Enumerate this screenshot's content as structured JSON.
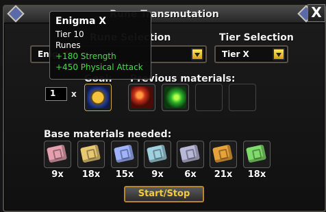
{
  "window": {
    "title": "Rune Transmutation",
    "close_label": "X"
  },
  "rune_selection": {
    "label": "Rune Selection",
    "value": "Enig"
  },
  "tier_selection": {
    "label": "Tier Selection",
    "value": "Tier X"
  },
  "goal": {
    "label": "Goal:",
    "quantity": "1",
    "multiplier": "x",
    "icon": "golden-rune-icon"
  },
  "previous_materials": {
    "label": "Previous materials:",
    "slots": [
      {
        "icon": "red-rune-icon",
        "filled": true
      },
      {
        "icon": "green-rune-icon",
        "filled": true
      },
      {
        "icon": "",
        "filled": false
      },
      {
        "icon": "",
        "filled": false
      }
    ]
  },
  "base_materials": {
    "label": "Base materials needed:",
    "items": [
      {
        "icon": "pink-rune-stone-icon",
        "count": "9x",
        "color": "#e5a0b0"
      },
      {
        "icon": "gold-rune-stone-icon",
        "count": "18x",
        "color": "#e8c870"
      },
      {
        "icon": "blue-rune-stone-icon",
        "count": "15x",
        "color": "#9fb3ff"
      },
      {
        "icon": "teal-rune-stone-icon",
        "count": "9x",
        "color": "#9fd0e0"
      },
      {
        "icon": "purple-rune-stone-icon",
        "count": "6x",
        "color": "#b8b8d8"
      },
      {
        "icon": "orange-rune-stone-icon",
        "count": "21x",
        "color": "#e8a23a"
      },
      {
        "icon": "green-rune-stone-icon",
        "count": "18x",
        "color": "#7fdc6a"
      }
    ]
  },
  "start_stop": {
    "label": "Start/Stop"
  },
  "tooltip": {
    "title": "Enigma X",
    "lines": [
      "Tier 10",
      "Runes"
    ],
    "bonuses": [
      "+180 Strength",
      "+450 Physical Attack"
    ]
  },
  "colors": {
    "accent_gold": "#f7c93e",
    "bonus_green": "#43e043",
    "window_bg": "#151515"
  }
}
